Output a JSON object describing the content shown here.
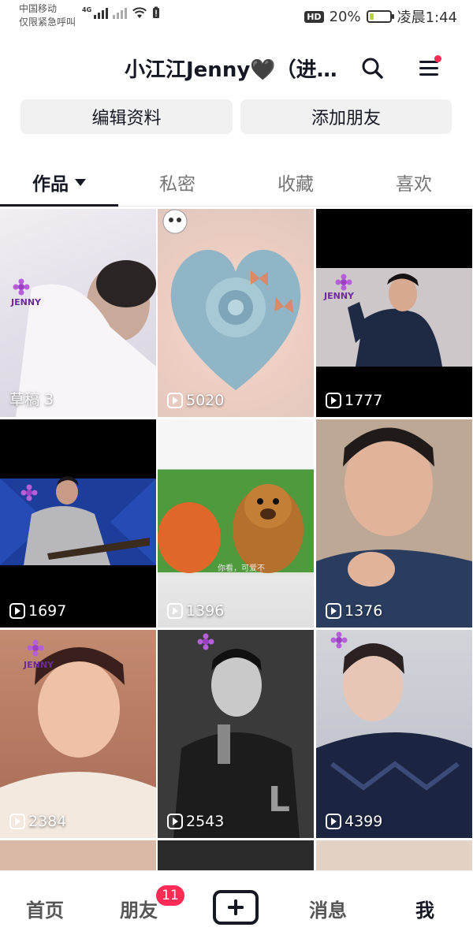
{
  "status": {
    "carrier": "中国移动",
    "carrier_sub": "仅限紧急呼叫",
    "net": "4G",
    "battery_pct": "20%",
    "battery_level": 0.2,
    "time": "凌晨1:44",
    "hd": "HD"
  },
  "header": {
    "title": "小江江Jenny🖤（进…",
    "search_icon": "search-icon",
    "menu_icon": "menu-icon"
  },
  "profile": {
    "edit_label": "编辑资料",
    "add_friend_label": "添加朋友"
  },
  "tabs": [
    {
      "label": "作品",
      "active": true
    },
    {
      "label": "私密",
      "active": false
    },
    {
      "label": "收藏",
      "active": false
    },
    {
      "label": "喜欢",
      "active": false
    }
  ],
  "videos": [
    {
      "label": "草稿 3",
      "type": "draft"
    },
    {
      "label": "5020",
      "type": "count"
    },
    {
      "label": "1777",
      "type": "count"
    },
    {
      "label": "1697",
      "type": "count"
    },
    {
      "label": "1396",
      "type": "count"
    },
    {
      "label": "1376",
      "type": "count"
    },
    {
      "label": "2384",
      "type": "count"
    },
    {
      "label": "2543",
      "type": "count"
    },
    {
      "label": "4399",
      "type": "count"
    }
  ],
  "overlays": {
    "watermark": "JENNY",
    "caption_bear": "你看，可爱不"
  },
  "colors": {
    "accent": "#fe2c55",
    "text": "#161823",
    "button_bg": "#f1f1f2"
  },
  "nav": {
    "home": "首页",
    "friends": "朋友",
    "friends_badge": "11",
    "messages": "消息",
    "me": "我"
  }
}
